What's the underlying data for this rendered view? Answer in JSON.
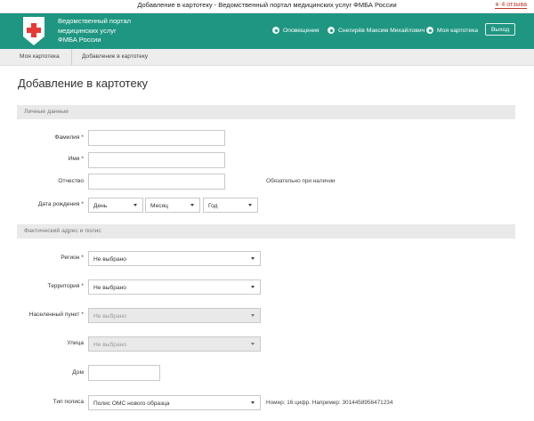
{
  "browser": {
    "tab_title": "Добавление в картотеку - Ведомственный портал медицинских услуг ФМБА России",
    "reviews": "✭ 4 отзыва"
  },
  "header": {
    "portal_line1": "Ведомственный портал",
    "portal_line2": "медицинских услуг",
    "portal_line3": "ФМБА России",
    "notifications": "Оповещения",
    "user_name": "Снегирёв Максим Михайлович",
    "my_card": "Моя картотека",
    "logout": "Выход"
  },
  "breadcrumb": {
    "item1": "Моя картотека",
    "item2": "Добавление в картотеку"
  },
  "page_title": "Добавление в картотеку",
  "sections": {
    "personal": "Личные данные",
    "address": "Фактический адрес и полис"
  },
  "form": {
    "lastname_label": "Фамилия",
    "firstname_label": "Имя",
    "patronymic_label": "Отчество",
    "patronymic_hint": "Обязательно при наличии",
    "birthdate_label": "Дата рождения",
    "day_value": "День",
    "month_value": "Месяц",
    "year_value": "Год",
    "region_label": "Регион",
    "region_value": "Не выбрано",
    "territory_label": "Территория",
    "territory_value": "Не выбрано",
    "settlement_label": "Населенный пункт",
    "settlement_value": "Не выбрано",
    "street_label": "Улица",
    "street_value": "Не выбрано",
    "house_label": "Дом",
    "policy_type_label": "Тип полиса",
    "policy_type_value": "Полис ОМС нового образца",
    "policy_hint": "Номер: 16 цифр. Например: 3014458956471234",
    "required_mark": "*"
  },
  "colors": {
    "header_bg": "#1f9682",
    "section_bg": "#e9e9e9",
    "breadcrumb_bg": "#ededed"
  },
  "icons": [
    "medical-cross-logo-icon",
    "bell-icon",
    "user-icon",
    "card-icon",
    "dropdown-arrow-icon"
  ]
}
